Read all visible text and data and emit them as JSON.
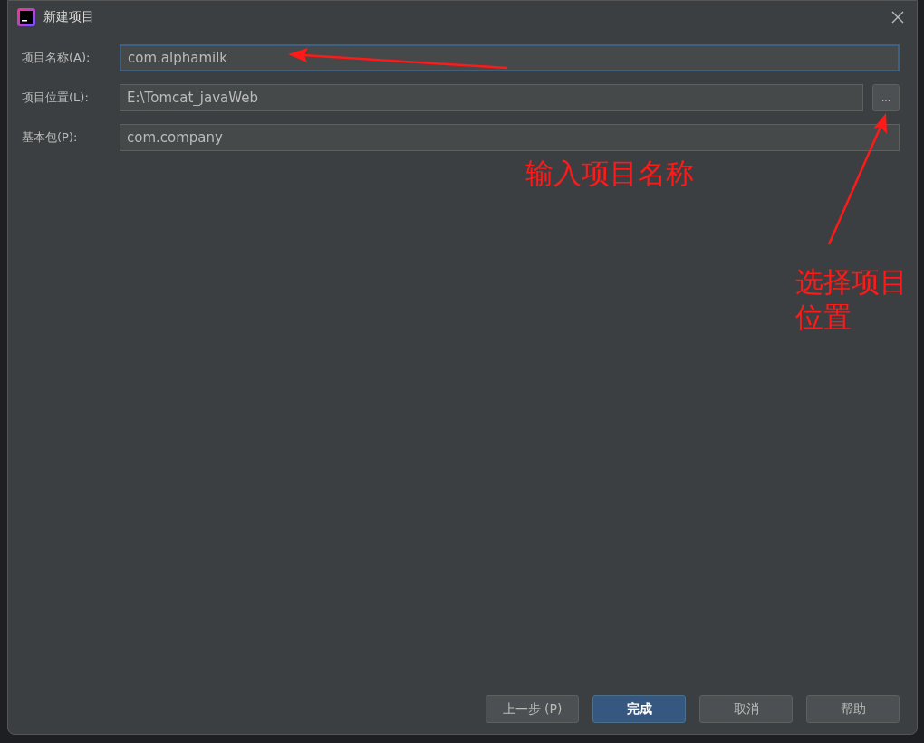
{
  "dialog": {
    "title": "新建项目"
  },
  "fields": [
    {
      "label": "项目名称(A):",
      "value": "com.alphamilk",
      "focused": true
    },
    {
      "label": "项目位置(L):",
      "value": "E:\\Tomcat_javaWeb",
      "focused": false,
      "browse": "..."
    },
    {
      "label": "基本包(P):",
      "value": "com.company",
      "focused": false
    }
  ],
  "buttons": [
    {
      "label": "上一步 (P)",
      "primary": false
    },
    {
      "label": "完成",
      "primary": true
    },
    {
      "label": "取消",
      "primary": false
    },
    {
      "label": "帮助",
      "primary": false
    }
  ],
  "annotations": [
    {
      "text": "输入项目名称"
    },
    {
      "text": "选择项目位置"
    }
  ]
}
